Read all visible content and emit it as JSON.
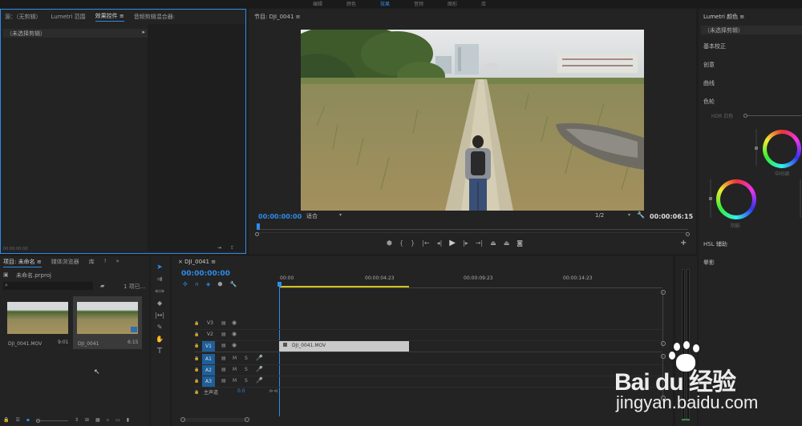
{
  "top_menu": [
    "编辑",
    "颜色",
    "效果",
    "音频",
    "图形",
    "库"
  ],
  "effects_panel": {
    "tabs": [
      "源：（无剪辑）",
      "Lumetri 范围",
      "效果控件",
      "音频剪辑混合器:"
    ],
    "clip_dropdown": "（未选择剪辑）",
    "timecode": "00:00:00:00"
  },
  "program_monitor": {
    "title": "节目: DJI_0041",
    "timecode_left": "00:00:00:00",
    "fit": "适合",
    "quality": "1/2",
    "timecode_right": "00:00:06:15"
  },
  "lumetri": {
    "title": "Lumetri 颜色",
    "clip_dropdown": "（未选择剪辑）",
    "sections": [
      "基本校正",
      "创意",
      "曲线",
      "色轮"
    ],
    "hdr_label": "HDR 白色",
    "midtone_label": "中间调",
    "shadow_label": "阴影",
    "hsl": "HSL 辅助",
    "vignette": "晕影"
  },
  "project": {
    "tabs": [
      "项目: 未命名",
      "媒体浏览器",
      "库"
    ],
    "file": "未命名.prproj",
    "count": "1 项已...",
    "items": [
      {
        "name": "DJI_0041.MOV",
        "duration": "9:01"
      },
      {
        "name": "DJI_0041",
        "duration": "6:15"
      }
    ]
  },
  "tools": [
    "selection-tool",
    "track-select-tool",
    "ripple-edit-tool",
    "razor-tool",
    "slip-tool",
    "pen-tool",
    "hand-tool",
    "type-tool"
  ],
  "timeline": {
    "tab": "DJI_0041",
    "timecode": "00:00:00:00",
    "ruler": [
      "00:00",
      "00:00:04:23",
      "00:00:09:23",
      "00:00:14:23"
    ],
    "video_tracks": [
      "V3",
      "V2",
      "V1"
    ],
    "audio_tracks": [
      "A1",
      "A2",
      "A3"
    ],
    "master_label": "主声道",
    "master_value": "0.0",
    "clip_label": "DJI_0041.MOV",
    "track_m": "M",
    "track_s": "S"
  },
  "watermark": {
    "brand": "Bai du 经验",
    "url": "jingyan.baidu.com"
  }
}
